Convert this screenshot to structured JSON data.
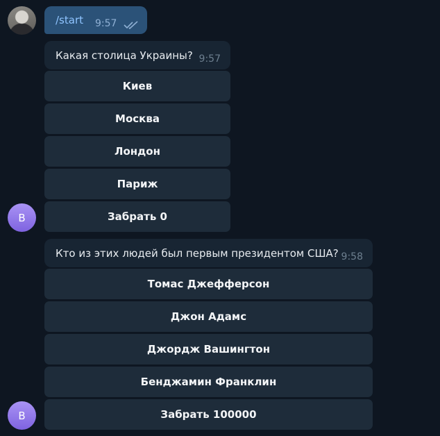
{
  "user_message": {
    "text": "/start",
    "time": "9:57",
    "read_icon": "double-check-icon"
  },
  "questions": [
    {
      "text": "Какая столица Украины?",
      "time": "9:57",
      "avatar_letter": "B",
      "buttons": [
        "Киев",
        "Москва",
        "Лондон",
        "Париж",
        "Забрать 0"
      ]
    },
    {
      "text": "Кто из этих людей был первым президентом США?",
      "time": "9:58",
      "avatar_letter": "B",
      "buttons": [
        "Томас Джефферсон",
        "Джон Адамс",
        "Джордж Вашингтон",
        "Бенджамин Франклин",
        "Забрать 100000"
      ]
    }
  ],
  "colors": {
    "background": "#0e1621",
    "outgoing_bubble": "#2b5278",
    "incoming_bubble": "#182533",
    "keyboard_button": "#1e2c3a",
    "bot_avatar": "#8b6ff0"
  }
}
